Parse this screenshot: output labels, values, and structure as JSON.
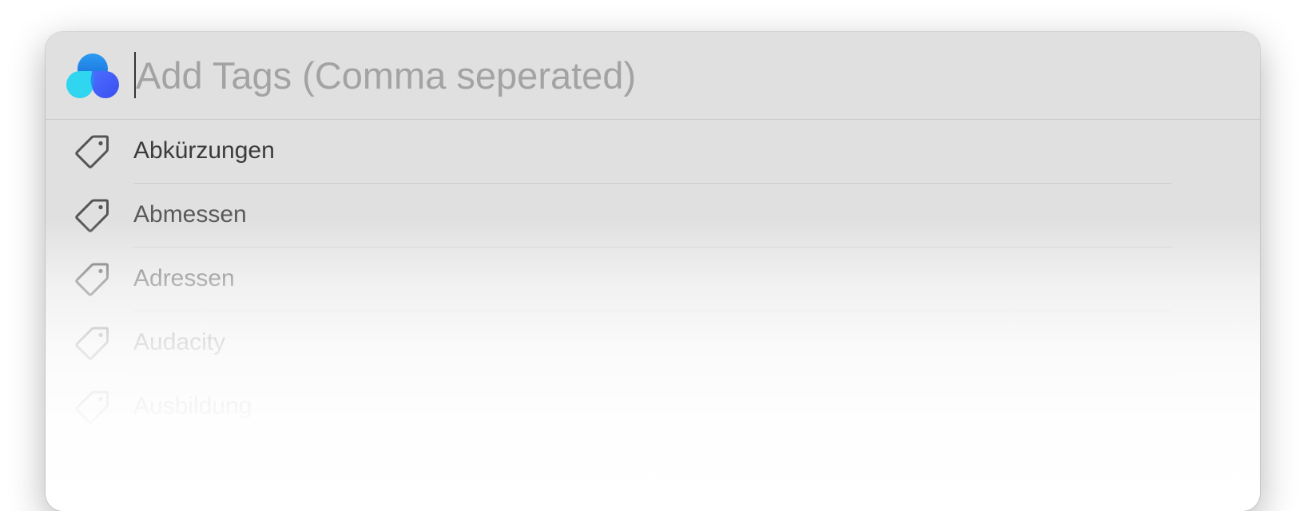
{
  "search": {
    "placeholder": "Add Tags (Comma seperated)",
    "value": ""
  },
  "app": {
    "logo_icon": "cloud-logo-icon",
    "colors": {
      "logo_cyan": "#2fd3ee",
      "logo_blue": "#1e8cf0",
      "logo_indigo": "#3f5bff"
    }
  },
  "tags": [
    {
      "label": "Abkürzungen",
      "icon": "tag-icon"
    },
    {
      "label": "Abmessen",
      "icon": "tag-icon"
    },
    {
      "label": "Adressen",
      "icon": "tag-icon"
    },
    {
      "label": "Audacity",
      "icon": "tag-icon"
    },
    {
      "label": "Ausbildung",
      "icon": "tag-icon"
    }
  ]
}
